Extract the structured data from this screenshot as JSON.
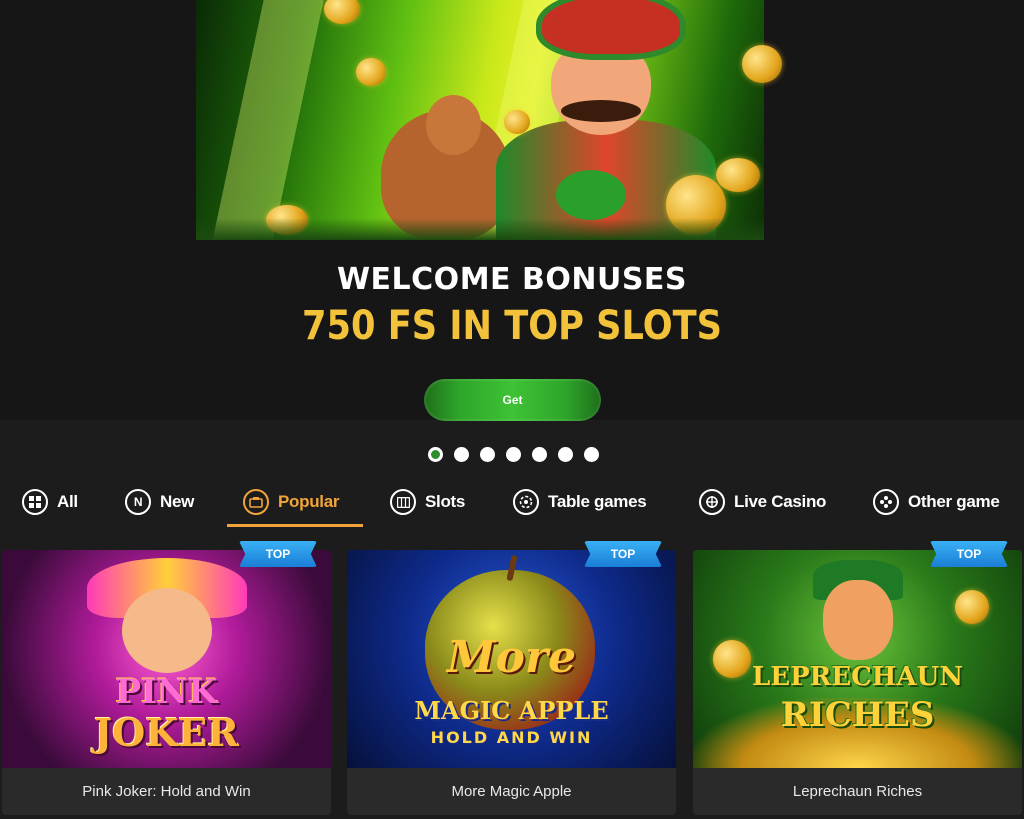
{
  "hero": {
    "title": "WELCOME BONUSES",
    "subtitle": "750 FS IN TOP SLOTS",
    "cta_label": "Get",
    "slide_count": 7,
    "active_slide": 1,
    "colors": {
      "title": "#ffffff",
      "subtitle": "#f2c23a",
      "cta": "#2ea52a"
    }
  },
  "tabs": [
    {
      "label": "All",
      "icon": "grid-icon",
      "active": false
    },
    {
      "label": "New",
      "icon": "new-n-icon",
      "active": false
    },
    {
      "label": "Popular",
      "icon": "popular-icon",
      "active": true
    },
    {
      "label": "Slots",
      "icon": "slots-icon",
      "active": false
    },
    {
      "label": "Table games",
      "icon": "chip-icon",
      "active": false
    },
    {
      "label": "Live Casino",
      "icon": "roulette-icon",
      "active": false
    },
    {
      "label": "Other game",
      "icon": "other-game-icon",
      "active": false
    }
  ],
  "active_color": "#f0a43a",
  "games": [
    {
      "name": "Pink Joker: Hold and Win",
      "badge": "TOP",
      "art_title_1": "PINK",
      "art_title_2": "JOKER"
    },
    {
      "name": "More Magic Apple",
      "badge": "TOP",
      "art_title_1": "More",
      "art_title_2": "MAGIC APPLE",
      "art_title_3": "HOLD AND WIN"
    },
    {
      "name": "Leprechaun Riches",
      "badge": "TOP",
      "art_title_1": "LEPRECHAUN",
      "art_title_2": "RICHES"
    }
  ]
}
